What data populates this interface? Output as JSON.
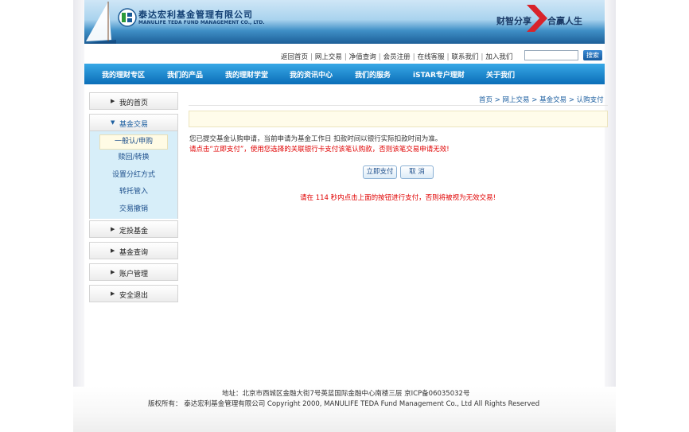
{
  "header": {
    "company_cn": "泰达宏利基金管理有限公司",
    "company_en": "MANULIFE TEDA FUND MANAGEMENT CO., LTD.",
    "slogan_left": "财智分享",
    "slogan_right": "合赢人生"
  },
  "toplinks": {
    "items": [
      "返回首页",
      "网上交易",
      "净值查询",
      "会员注册",
      "在线客服",
      "联系我们",
      "加入我们"
    ],
    "separator": "|",
    "search_value": "",
    "search_button": "搜索"
  },
  "nav": {
    "items": [
      "我的理财专区",
      "我们的产品",
      "我的理财学堂",
      "我的资讯中心",
      "我们的服务",
      "iSTAR专户理财",
      "关于我们"
    ]
  },
  "sidebar": {
    "home": "我的首页",
    "fund_trade": "基金交易",
    "sub_items": [
      "一般认/申购",
      "赎回/转换",
      "设置分红方式",
      "转托管入",
      "交易撤销"
    ],
    "after": [
      "定投基金",
      "基金查询",
      "账户管理",
      "安全退出"
    ],
    "collapsed_marker": "▶",
    "expanded_marker": "▼"
  },
  "breadcrumb": {
    "items": [
      "首页",
      "网上交易",
      "基金交易",
      "认购支付"
    ],
    "separator": ">"
  },
  "content": {
    "message1": "您已提交基金认购申请，当前申请为基金工作日 扣款时间以银行实际扣款时间为准。",
    "message2": "请点击“立即支付”，使用您选择的关联银行卡支付该笔认购款，否则该笔交易申请无效!",
    "pay_button": "立即支付",
    "cancel_button": "取 消",
    "countdown": "请在  114 秒内点击上面的按钮进行支付，否则将被视为无效交易!"
  },
  "footer": {
    "address": "地址：北京市西城区金融大街7号英蓝国际金融中心南楼三层  京ICP备06035032号",
    "copyright": "版权所有：  泰达宏利基金管理有限公司  Copyright 2000, MANULIFE TEDA Fund Management Co., Ltd All Rights Reserved"
  },
  "colors": {
    "nav_bg": "#0b6eb8",
    "link": "#1d5fa0",
    "warning": "#e00000",
    "submenu_bg": "#d7eef9"
  }
}
